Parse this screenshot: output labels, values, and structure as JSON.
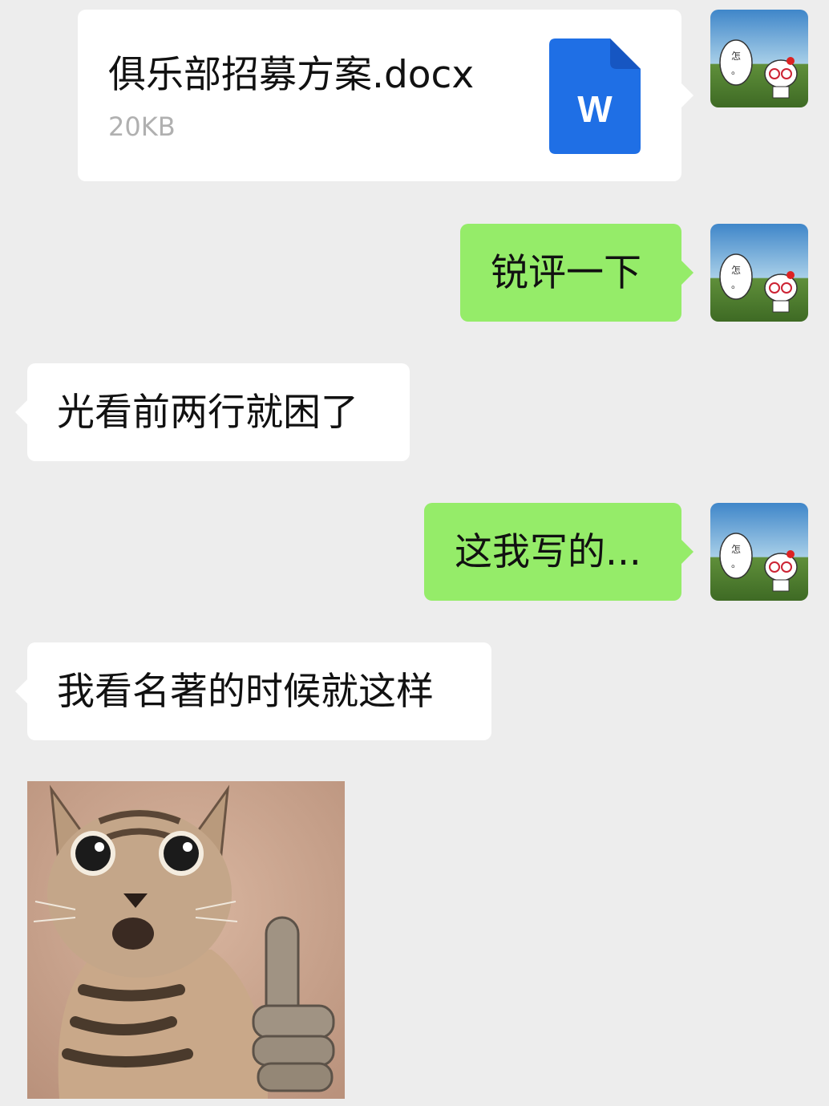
{
  "messages": [
    {
      "id": "file",
      "side": "right",
      "type": "file",
      "file_name": "俱乐部招募方案.docx",
      "file_size": "20KB",
      "file_icon_label": "W",
      "file_icon_color": "#1f6fe5"
    },
    {
      "id": "m1",
      "side": "right",
      "type": "text",
      "text": "锐评一下"
    },
    {
      "id": "m2",
      "side": "left",
      "type": "text",
      "text": "光看前两行就困了"
    },
    {
      "id": "m3",
      "side": "right",
      "type": "text",
      "text": "这我写的..."
    },
    {
      "id": "m4",
      "side": "left",
      "type": "text",
      "text": "我看名著的时候就这样"
    },
    {
      "id": "m5",
      "side": "left",
      "type": "sticker",
      "sticker": "cat-thumbs-up-sticker"
    }
  ],
  "colors": {
    "background": "#ededed",
    "green_bubble": "#95ec69",
    "white_bubble": "#ffffff",
    "doc_icon": "#1f6fe5"
  },
  "avatar": {
    "speech_text": "怎\n。",
    "icon": "hello-kitty-avatar"
  }
}
